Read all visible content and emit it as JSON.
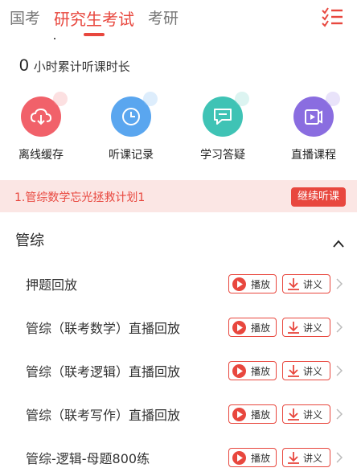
{
  "tabs": [
    {
      "label": "国考",
      "active": false
    },
    {
      "label": "研究生考试",
      "active": true
    },
    {
      "label": "考研",
      "active": false
    }
  ],
  "colors": {
    "accent": "#e8473e",
    "banner_bg": "#fbe6e4"
  },
  "hours": {
    "value": "0",
    "label": "小时累计听课时长"
  },
  "features": [
    {
      "label": "离线缓存",
      "icon": "cloud-download-icon",
      "color": "#f1616a",
      "halo": "#f7a5a9"
    },
    {
      "label": "听课记录",
      "icon": "clock-icon",
      "color": "#5aa6ef",
      "halo": "#9fcaf5"
    },
    {
      "label": "学习答疑",
      "icon": "chat-icon",
      "color": "#3fc3b5",
      "halo": "#9be0d8"
    },
    {
      "label": "直播课程",
      "icon": "video-play-icon",
      "color": "#8a6de0",
      "halo": "#bfaef0"
    }
  ],
  "banner": {
    "text": "1.管综数学忘光拯救计划1",
    "button": "继续听课"
  },
  "section": {
    "title": "管综",
    "expanded": true
  },
  "rows": [
    {
      "title": "押题回放",
      "play": "播放",
      "handout": "讲义"
    },
    {
      "title": "管综（联考数学）直播回放",
      "play": "播放",
      "handout": "讲义"
    },
    {
      "title": "管综（联考逻辑）直播回放",
      "play": "播放",
      "handout": "讲义"
    },
    {
      "title": "管综（联考写作）直播回放",
      "play": "播放",
      "handout": "讲义"
    },
    {
      "title": "管综-逻辑-母题800练",
      "play": "播放",
      "handout": "讲义"
    }
  ]
}
